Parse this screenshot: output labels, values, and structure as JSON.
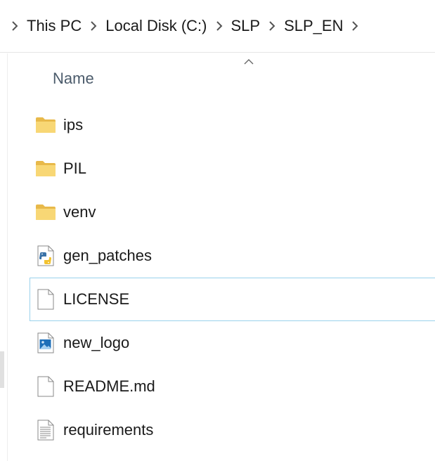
{
  "breadcrumb": {
    "items": [
      {
        "label": "This PC"
      },
      {
        "label": "Local Disk (C:)"
      },
      {
        "label": "SLP"
      },
      {
        "label": "SLP_EN"
      }
    ]
  },
  "columns": {
    "name_label": "Name",
    "sort": "ascending"
  },
  "files": [
    {
      "name": "ips",
      "icon": "folder-icon"
    },
    {
      "name": "PIL",
      "icon": "folder-icon"
    },
    {
      "name": "venv",
      "icon": "folder-icon"
    },
    {
      "name": "gen_patches",
      "icon": "python-file-icon"
    },
    {
      "name": "LICENSE",
      "icon": "blank-file-icon",
      "focused": true
    },
    {
      "name": "new_logo",
      "icon": "image-file-icon"
    },
    {
      "name": "README.md",
      "icon": "blank-file-icon"
    },
    {
      "name": "requirements",
      "icon": "text-file-icon"
    }
  ],
  "colors": {
    "folder": "#f8d775",
    "folder_dark": "#e8b94a",
    "focus_border": "#99d1ec",
    "header_text": "#4b5b6b"
  }
}
